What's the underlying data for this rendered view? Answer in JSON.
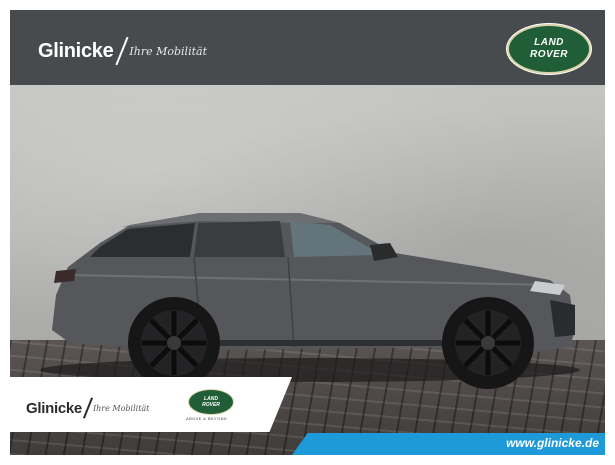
{
  "header": {
    "brand_name": "Glinicke",
    "brand_tagline": "Ihre Mobilität",
    "logo_line1": "LAND",
    "logo_line2": "ROVER"
  },
  "dealer_badge": {
    "brand_name": "Glinicke",
    "brand_tagline": "Ihre Mobilität",
    "logo_line1": "LAND",
    "logo_line2": "ROVER",
    "motto": "ABOVE & BEYOND"
  },
  "footer": {
    "url": "www.glinicke.de"
  },
  "colors": {
    "header_bg": "#484b4d",
    "logo_green": "#1f5e36",
    "url_bar": "#1e9ad8",
    "car_body": "#55575a"
  }
}
